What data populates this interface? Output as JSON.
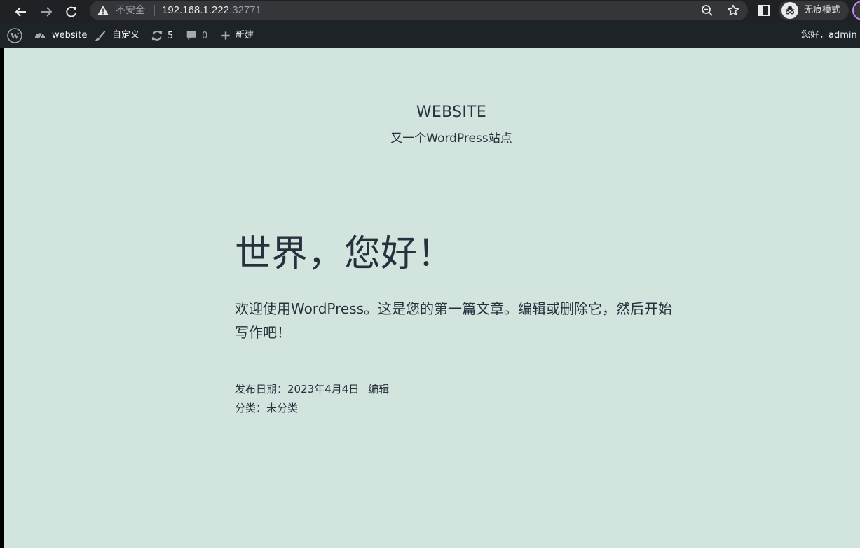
{
  "browser": {
    "security_label": "不安全",
    "url_host": "192.168.1.222",
    "url_port": ":32771",
    "incognito_label": "无痕模式"
  },
  "admin_bar": {
    "site_name": "website",
    "customize_label": "自定义",
    "updates_count": "5",
    "comments_count": "0",
    "new_label": "新建",
    "greeting": "您好，admin"
  },
  "site": {
    "title": "WEBSITE",
    "description": "又一个WordPress站点"
  },
  "post": {
    "title": "世界，您好！",
    "body": "欢迎使用WordPress。这是您的第一篇文章。编辑或删除它，然后开始写作吧！",
    "date_prefix": "发布日期：",
    "date": "2023年4月4日",
    "edit_label": "编辑",
    "category_prefix": "分类：",
    "category": "未分类"
  },
  "colors": {
    "page_background": "#d1e4dd",
    "admin_bar": "#1d2327",
    "browser_chrome": "#202124",
    "text": "#28303d"
  }
}
